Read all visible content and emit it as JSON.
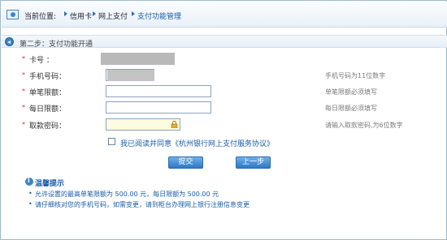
{
  "breadcrumb": {
    "prefix": "当前位置:",
    "items": [
      "信用卡",
      "网上支付",
      "支付功能管理"
    ]
  },
  "step": {
    "title": "第二步：支付功能开通"
  },
  "form": {
    "card_label": "卡号 ：",
    "phone_label": "手机号码：",
    "phone_hint": "手机号码为11位数字",
    "single_limit_label": "单笔限额：",
    "single_limit_hint": "单笔限额必须填写",
    "daily_limit_label": "每日限额：",
    "daily_limit_hint": "每日限额必须填写",
    "password_label": "取款密码：",
    "password_hint": "请输入取款密码,为6位数字",
    "required_mark": "*"
  },
  "agreement": {
    "text": "我已阅读并同意《杭州银行网上支付服务协议》"
  },
  "buttons": {
    "submit": "提交",
    "back": "上一步"
  },
  "tips": {
    "title": "温馨提示",
    "lines": [
      "允许设置的最高单笔限额为  500.00 元，每日限额为  500.00 元",
      "请仔细核对您的手机号码，如需变更，请到柜台办理网上银行注册信息变更"
    ],
    "bullet": "•"
  },
  "colors": {
    "accent": "#1a5ca8",
    "button": "#2e78c6",
    "border": "#9fb8cf"
  }
}
